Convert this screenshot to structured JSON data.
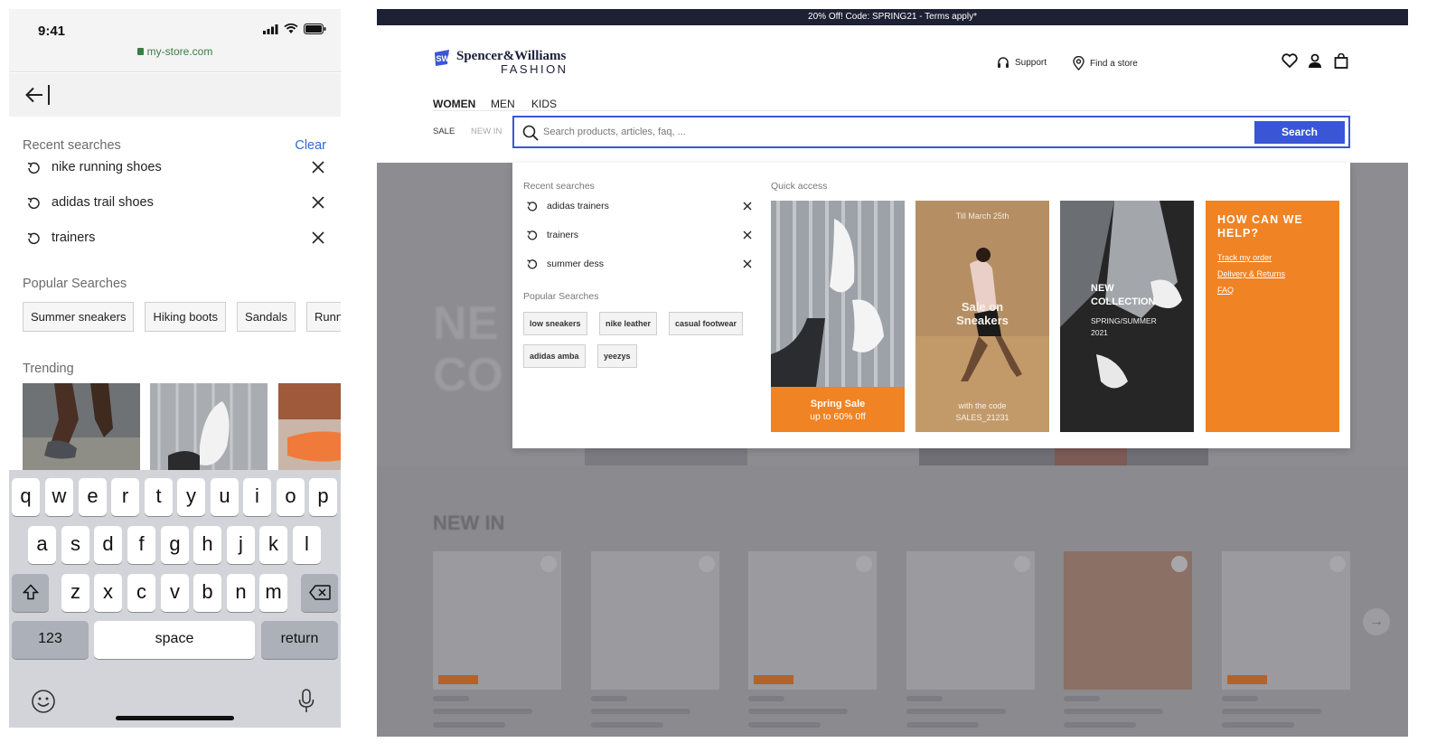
{
  "phone": {
    "status": {
      "time": "9:41",
      "url": "my-store.com"
    },
    "recent": {
      "heading": "Recent searches",
      "clear_label": "Clear",
      "items": [
        "nike running shoes",
        "adidas trail shoes",
        "trainers"
      ]
    },
    "popular": {
      "heading": "Popular Searches",
      "items": [
        "Summer sneakers",
        "Hiking boots",
        "Sandals",
        "Running"
      ]
    },
    "trending": {
      "heading": "Trending"
    },
    "keyboard": {
      "row1": [
        "q",
        "w",
        "e",
        "r",
        "t",
        "y",
        "u",
        "i",
        "o",
        "p"
      ],
      "row2": [
        "a",
        "s",
        "d",
        "f",
        "g",
        "h",
        "j",
        "k",
        "l"
      ],
      "row3": [
        "z",
        "x",
        "c",
        "v",
        "b",
        "n",
        "m"
      ],
      "numbers_label": "123",
      "space_label": "space",
      "return_label": "return"
    }
  },
  "desktop": {
    "promo": "20% Off! Code: SPRING21 - Terms apply*",
    "brand": {
      "name_top": "Spencer&Williams",
      "name_bottom": "FASHION",
      "mark": "SW"
    },
    "util": {
      "support": "Support",
      "find_store": "Find a store"
    },
    "nav": [
      "WOMEN",
      "MEN",
      "KIDS"
    ],
    "subnav": [
      "SALE",
      "NEW IN"
    ],
    "search": {
      "placeholder": "Search products, articles, faq, ...",
      "button": "Search"
    },
    "dropdown": {
      "recent_heading": "Recent searches",
      "recent": [
        "adidas trainers",
        "trainers",
        "summer dess"
      ],
      "popular_heading": "Popular Searches",
      "popular": [
        "low sneakers",
        "nike leather",
        "casual footwear",
        "adidas amba",
        "yeezys"
      ],
      "quick_heading": "Quick access",
      "cards": {
        "spring": {
          "title": "Spring Sale",
          "subtitle": "up to 60% 0ff"
        },
        "sale": {
          "date": "Till March 25th",
          "title": "Sale on Sneakers",
          "code_label": "with the code",
          "code": "SALES_21231"
        },
        "collection": {
          "title": "NEW COLLECTION",
          "subtitle": "SPRING/SUMMER 2021"
        },
        "help": {
          "title": "HOW CAN WE HELP?",
          "links": [
            "Track my order",
            "Delivery & Returns",
            "FAQ"
          ]
        }
      }
    },
    "section_title": "NEW IN",
    "colors": {
      "accent": "#3a56d6",
      "orange": "#f08323",
      "promo_bg": "#1d2133"
    }
  }
}
